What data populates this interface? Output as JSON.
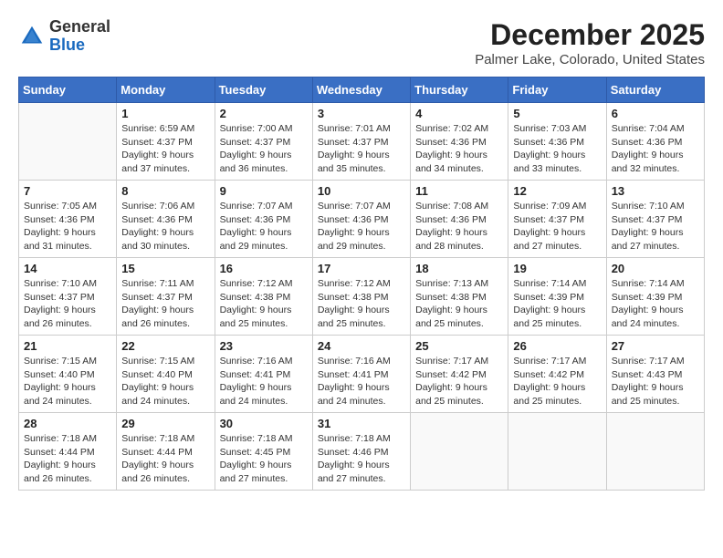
{
  "header": {
    "logo_line1": "General",
    "logo_line2": "Blue",
    "title": "December 2025",
    "subtitle": "Palmer Lake, Colorado, United States"
  },
  "days_of_week": [
    "Sunday",
    "Monday",
    "Tuesday",
    "Wednesday",
    "Thursday",
    "Friday",
    "Saturday"
  ],
  "weeks": [
    [
      {
        "day": "",
        "info": ""
      },
      {
        "day": "1",
        "info": "Sunrise: 6:59 AM\nSunset: 4:37 PM\nDaylight: 9 hours\nand 37 minutes."
      },
      {
        "day": "2",
        "info": "Sunrise: 7:00 AM\nSunset: 4:37 PM\nDaylight: 9 hours\nand 36 minutes."
      },
      {
        "day": "3",
        "info": "Sunrise: 7:01 AM\nSunset: 4:37 PM\nDaylight: 9 hours\nand 35 minutes."
      },
      {
        "day": "4",
        "info": "Sunrise: 7:02 AM\nSunset: 4:36 PM\nDaylight: 9 hours\nand 34 minutes."
      },
      {
        "day": "5",
        "info": "Sunrise: 7:03 AM\nSunset: 4:36 PM\nDaylight: 9 hours\nand 33 minutes."
      },
      {
        "day": "6",
        "info": "Sunrise: 7:04 AM\nSunset: 4:36 PM\nDaylight: 9 hours\nand 32 minutes."
      }
    ],
    [
      {
        "day": "7",
        "info": "Sunrise: 7:05 AM\nSunset: 4:36 PM\nDaylight: 9 hours\nand 31 minutes."
      },
      {
        "day": "8",
        "info": "Sunrise: 7:06 AM\nSunset: 4:36 PM\nDaylight: 9 hours\nand 30 minutes."
      },
      {
        "day": "9",
        "info": "Sunrise: 7:07 AM\nSunset: 4:36 PM\nDaylight: 9 hours\nand 29 minutes."
      },
      {
        "day": "10",
        "info": "Sunrise: 7:07 AM\nSunset: 4:36 PM\nDaylight: 9 hours\nand 29 minutes."
      },
      {
        "day": "11",
        "info": "Sunrise: 7:08 AM\nSunset: 4:36 PM\nDaylight: 9 hours\nand 28 minutes."
      },
      {
        "day": "12",
        "info": "Sunrise: 7:09 AM\nSunset: 4:37 PM\nDaylight: 9 hours\nand 27 minutes."
      },
      {
        "day": "13",
        "info": "Sunrise: 7:10 AM\nSunset: 4:37 PM\nDaylight: 9 hours\nand 27 minutes."
      }
    ],
    [
      {
        "day": "14",
        "info": "Sunrise: 7:10 AM\nSunset: 4:37 PM\nDaylight: 9 hours\nand 26 minutes."
      },
      {
        "day": "15",
        "info": "Sunrise: 7:11 AM\nSunset: 4:37 PM\nDaylight: 9 hours\nand 26 minutes."
      },
      {
        "day": "16",
        "info": "Sunrise: 7:12 AM\nSunset: 4:38 PM\nDaylight: 9 hours\nand 25 minutes."
      },
      {
        "day": "17",
        "info": "Sunrise: 7:12 AM\nSunset: 4:38 PM\nDaylight: 9 hours\nand 25 minutes."
      },
      {
        "day": "18",
        "info": "Sunrise: 7:13 AM\nSunset: 4:38 PM\nDaylight: 9 hours\nand 25 minutes."
      },
      {
        "day": "19",
        "info": "Sunrise: 7:14 AM\nSunset: 4:39 PM\nDaylight: 9 hours\nand 25 minutes."
      },
      {
        "day": "20",
        "info": "Sunrise: 7:14 AM\nSunset: 4:39 PM\nDaylight: 9 hours\nand 24 minutes."
      }
    ],
    [
      {
        "day": "21",
        "info": "Sunrise: 7:15 AM\nSunset: 4:40 PM\nDaylight: 9 hours\nand 24 minutes."
      },
      {
        "day": "22",
        "info": "Sunrise: 7:15 AM\nSunset: 4:40 PM\nDaylight: 9 hours\nand 24 minutes."
      },
      {
        "day": "23",
        "info": "Sunrise: 7:16 AM\nSunset: 4:41 PM\nDaylight: 9 hours\nand 24 minutes."
      },
      {
        "day": "24",
        "info": "Sunrise: 7:16 AM\nSunset: 4:41 PM\nDaylight: 9 hours\nand 24 minutes."
      },
      {
        "day": "25",
        "info": "Sunrise: 7:17 AM\nSunset: 4:42 PM\nDaylight: 9 hours\nand 25 minutes."
      },
      {
        "day": "26",
        "info": "Sunrise: 7:17 AM\nSunset: 4:42 PM\nDaylight: 9 hours\nand 25 minutes."
      },
      {
        "day": "27",
        "info": "Sunrise: 7:17 AM\nSunset: 4:43 PM\nDaylight: 9 hours\nand 25 minutes."
      }
    ],
    [
      {
        "day": "28",
        "info": "Sunrise: 7:18 AM\nSunset: 4:44 PM\nDaylight: 9 hours\nand 26 minutes."
      },
      {
        "day": "29",
        "info": "Sunrise: 7:18 AM\nSunset: 4:44 PM\nDaylight: 9 hours\nand 26 minutes."
      },
      {
        "day": "30",
        "info": "Sunrise: 7:18 AM\nSunset: 4:45 PM\nDaylight: 9 hours\nand 27 minutes."
      },
      {
        "day": "31",
        "info": "Sunrise: 7:18 AM\nSunset: 4:46 PM\nDaylight: 9 hours\nand 27 minutes."
      },
      {
        "day": "",
        "info": ""
      },
      {
        "day": "",
        "info": ""
      },
      {
        "day": "",
        "info": ""
      }
    ]
  ]
}
